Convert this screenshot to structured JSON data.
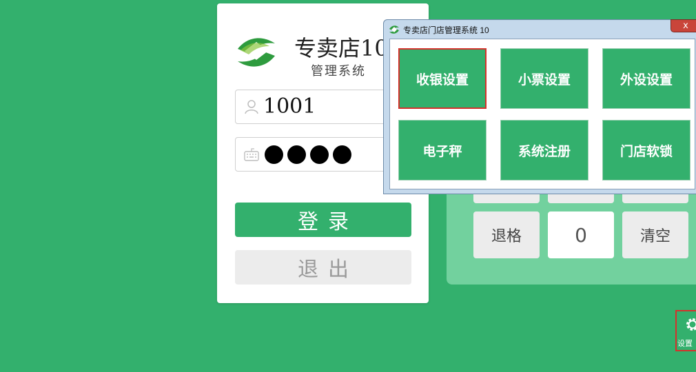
{
  "login": {
    "brand_title": "专卖店10",
    "brand_subtitle": "管理系统",
    "username_value": "1001",
    "password_dot_count": 4,
    "login_label": "登录",
    "exit_label": "退出"
  },
  "keypad": {
    "backspace_label": "退格",
    "display_value": "0",
    "clear_label": "清空"
  },
  "dialog": {
    "title": "专卖店门店管理系统 10",
    "close_label": "x",
    "buttons": [
      {
        "label": "收银设置"
      },
      {
        "label": "小票设置"
      },
      {
        "label": "外设设置"
      },
      {
        "label": "电子秤"
      },
      {
        "label": "系统注册"
      },
      {
        "label": "门店软锁"
      }
    ]
  },
  "settings": {
    "label": "设置"
  },
  "colors": {
    "brand_green": "#33b06d",
    "highlight_red": "#d6302b"
  }
}
